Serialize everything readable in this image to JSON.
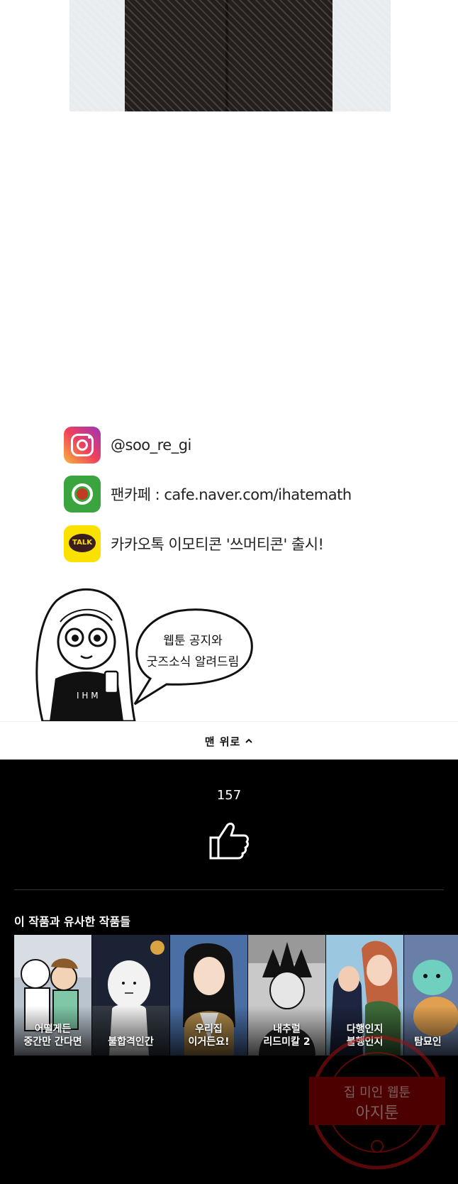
{
  "social": {
    "instagram": "@soo_re_gi",
    "cafe": "팬카페 : cafe.naver.com/ihatemath",
    "kakao": "카카오톡 이모티콘 '쓰머티콘' 출시!",
    "kakao_icon_text": "TALK"
  },
  "speech": {
    "line1": "웹툰 공지와",
    "line2": "굿즈소식 알려드림"
  },
  "shirt_text": "I H M",
  "top_button": "맨 위로",
  "likes": "157",
  "similar": {
    "title": "이 작품과 유사한 작품들",
    "items": [
      {
        "title": "어떨게든\n중간만 간다면",
        "bg": "#b9c4cf"
      },
      {
        "title": "불합격인간",
        "bg": "#1a2233"
      },
      {
        "title": "우리집\n이거든요!",
        "bg": "#4a6fa5"
      },
      {
        "title": "내추럴\n리드미칼 2",
        "bg": "#c9c9c9"
      },
      {
        "title": "다행인지\n불행인지",
        "bg": "#9bc7e0"
      },
      {
        "title": "탐묘인",
        "bg": "#6a7fa8"
      }
    ]
  },
  "watermark": {
    "line1": "집 미인 웹툰",
    "line2": "아지툰"
  },
  "colors": {
    "background": "#ffffff",
    "footer": "#000000",
    "stamp": "#8b0000"
  }
}
